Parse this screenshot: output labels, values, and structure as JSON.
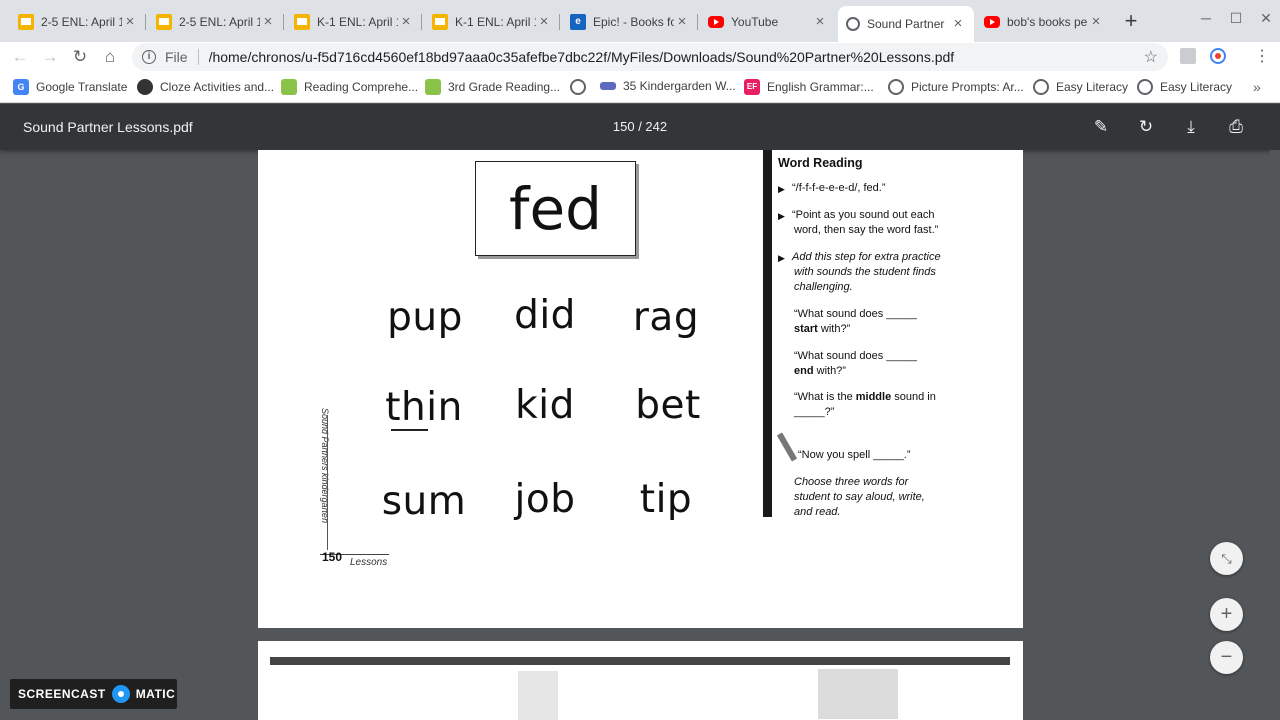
{
  "tabs": [
    {
      "title": "2-5 ENL: April 1",
      "icon": "slides-icon"
    },
    {
      "title": "2-5 ENL: April 1",
      "icon": "slides-icon"
    },
    {
      "title": "K-1 ENL: April 1",
      "icon": "slides-icon"
    },
    {
      "title": "K-1 ENL: April 1",
      "icon": "slides-icon"
    },
    {
      "title": "Epic! - Books fo",
      "icon": "epic-icon"
    },
    {
      "title": "YouTube",
      "icon": "youtube-icon"
    },
    {
      "title": "Sound Partner",
      "icon": "globe-icon"
    },
    {
      "title": "bob's books pe",
      "icon": "youtube-icon"
    }
  ],
  "active_tab_index": 6,
  "address": {
    "scheme": "File",
    "url": "/home/chronos/u-f5d716cd4560ef18bd97aaa0c35afefbe7dbc22f/MyFiles/Downloads/Sound%20Partner%20Lessons.pdf"
  },
  "bookmarks": [
    {
      "label": "Google Translate",
      "icon": "google-translate-icon"
    },
    {
      "label": "Cloze Activities and...",
      "icon": "cloze-icon"
    },
    {
      "label": "Reading Comprehe...",
      "icon": "reading-icon"
    },
    {
      "label": "3rd Grade Reading...",
      "icon": "reading-icon"
    },
    {
      "label": "",
      "icon": "globe-icon"
    },
    {
      "label": "35 Kindergarden W...",
      "icon": "kindergarten-icon"
    },
    {
      "label": "English Grammar:...",
      "icon": "ef-icon"
    },
    {
      "label": "Picture Prompts: Ar...",
      "icon": "globe-icon"
    },
    {
      "label": "Easy Literacy",
      "icon": "globe-icon"
    },
    {
      "label": "Easy Literacy",
      "icon": "globe-icon"
    }
  ],
  "pdf": {
    "title": "Sound Partner Lessons.pdf",
    "page_indicator": "150 / 242"
  },
  "page": {
    "card_word": "fed",
    "words": [
      "pup",
      "did",
      "rag",
      "thin",
      "kid",
      "bet",
      "sum",
      "job",
      "tip"
    ],
    "side_label": "Sound Partners kindergarten",
    "page_number": "150",
    "footer_label": "Lessons",
    "panel": {
      "heading": "Word Reading",
      "bullet1": "“/f-f-f-e-e-e-d/, fed.”",
      "bullet2_l1": "“Point as you sound out each",
      "bullet2_l2": "word, then say the word fast.”",
      "bullet3_l1": "Add this step for extra practice",
      "bullet3_l2": "with sounds the student finds",
      "bullet3_l3": "challenging.",
      "q1_l1": "“What sound does _____",
      "q1_b": "start",
      "q1_l2": " with?”",
      "q2_l1": "“What sound does _____",
      "q2_b": "end",
      "q2_l2": " with?”",
      "q3_a": "“What is the ",
      "q3_b": "middle",
      "q3_c": " sound in",
      "q3_l2": "_____?”",
      "spell": "“Now you spell _____.”",
      "choose_l1": "Choose three words for",
      "choose_l2": "student to say aloud, write,",
      "choose_l3": "and read."
    }
  },
  "watermark": {
    "left": "SCREENCAST",
    "right": "MATIC"
  }
}
